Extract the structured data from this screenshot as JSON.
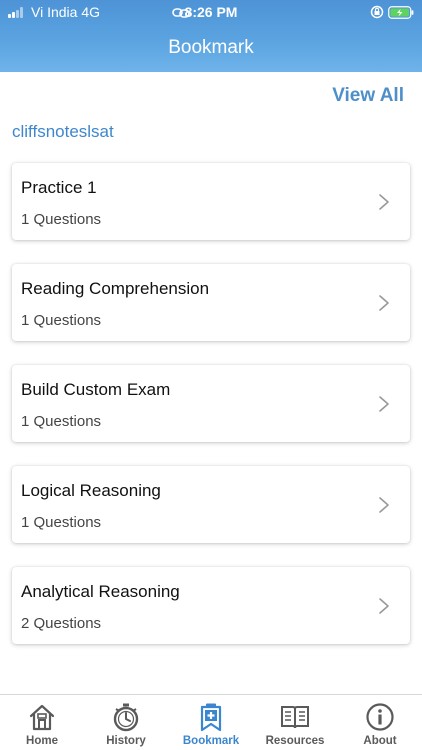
{
  "status_bar": {
    "carrier": "Vi India  4G",
    "time": "8:26 PM"
  },
  "header": {
    "title": "Bookmark"
  },
  "view_all_label": "View All",
  "section_title": "cliffsnoteslsat",
  "cards": [
    {
      "title": "Practice 1",
      "count": "1 Questions"
    },
    {
      "title": "Reading Comprehension",
      "count": "1 Questions"
    },
    {
      "title": "Build Custom Exam",
      "count": "1 Questions"
    },
    {
      "title": "Logical Reasoning",
      "count": "1 Questions"
    },
    {
      "title": "Analytical Reasoning",
      "count": "2 Questions"
    }
  ],
  "tabs": [
    {
      "label": "Home",
      "icon": "home-icon"
    },
    {
      "label": "History",
      "icon": "stopwatch-icon"
    },
    {
      "label": "Bookmark",
      "icon": "bookmark-icon",
      "active": true
    },
    {
      "label": "Resources",
      "icon": "book-icon"
    },
    {
      "label": "About",
      "icon": "info-icon"
    }
  ],
  "colors": {
    "header": "#5aa3e0",
    "accent": "#3e87cc",
    "tab_inactive": "#5a5a5a"
  }
}
